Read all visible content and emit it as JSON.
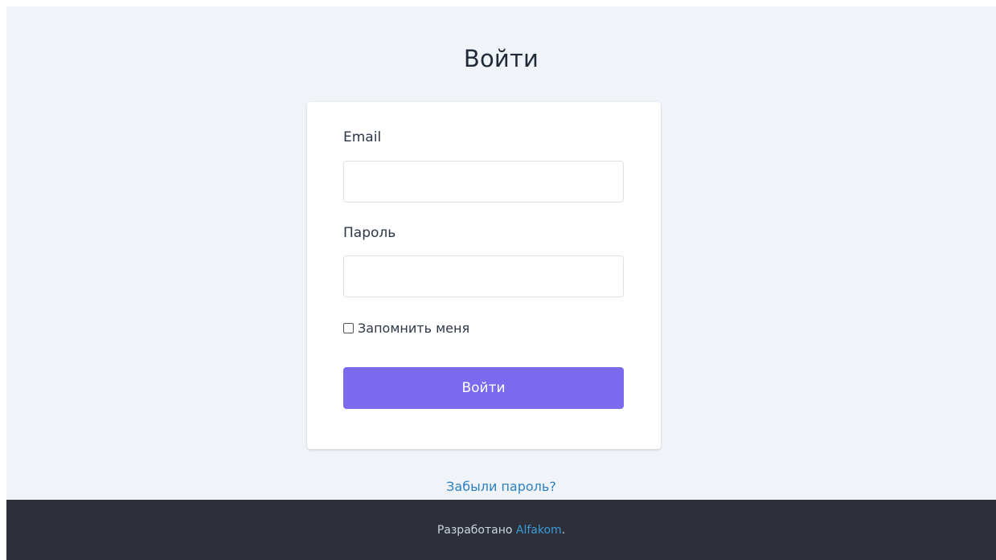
{
  "page": {
    "title": "Войти"
  },
  "form": {
    "email_label": "Email",
    "email_value": "",
    "password_label": "Пароль",
    "password_value": "",
    "remember_label": "Запомнить меня",
    "remember_checked": false,
    "submit_label": "Войти"
  },
  "links": {
    "forgot_password": "Забыли пароль?"
  },
  "footer": {
    "prefix": "Разработано ",
    "brand": "Alfakom",
    "suffix": "."
  },
  "colors": {
    "accent": "#7c6aee",
    "link": "#2b80c6",
    "background": "#f0f4f8",
    "footer": "#2d3038"
  }
}
